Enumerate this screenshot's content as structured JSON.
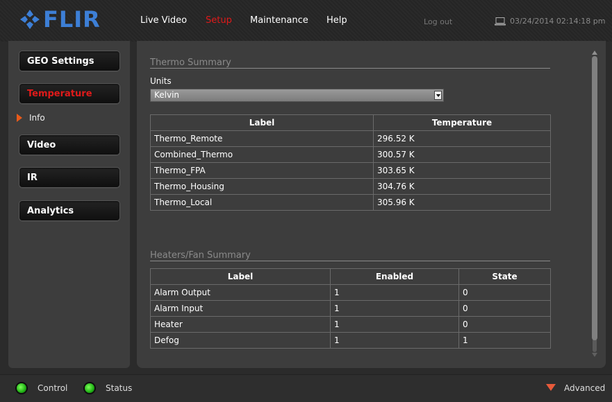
{
  "header": {
    "logo_text": "FLIR",
    "nav": [
      "Live Video",
      "Setup",
      "Maintenance",
      "Help"
    ],
    "active_nav": "Setup",
    "logout_label": "Log out",
    "datetime": "03/24/2014 02:14:18 pm",
    "colors": {
      "accent": "#e01a1a",
      "brand": "#3d7fd6"
    }
  },
  "sidebar": {
    "items": [
      {
        "label": "GEO Settings"
      },
      {
        "label": "Temperature"
      },
      {
        "label": "Video"
      },
      {
        "label": "IR"
      },
      {
        "label": "Analytics"
      }
    ],
    "active_item": "Temperature",
    "sub_item": "Info"
  },
  "thermo": {
    "title": "Thermo Summary",
    "units_label": "Units",
    "units_value": "Kelvin",
    "columns": [
      "Label",
      "Temperature"
    ],
    "rows": [
      [
        "Thermo_Remote",
        "296.52 K"
      ],
      [
        "Combined_Thermo",
        "300.57 K"
      ],
      [
        "Thermo_FPA",
        "303.65 K"
      ],
      [
        "Thermo_Housing",
        "304.76 K"
      ],
      [
        "Thermo_Local",
        "305.96 K"
      ]
    ]
  },
  "heaters": {
    "title": "Heaters/Fan Summary",
    "columns": [
      "Label",
      "Enabled",
      "State"
    ],
    "rows": [
      [
        "Alarm Output",
        "1",
        "0"
      ],
      [
        "Alarm Input",
        "1",
        "0"
      ],
      [
        "Heater",
        "1",
        "0"
      ],
      [
        "Defog",
        "1",
        "1"
      ]
    ]
  },
  "footer": {
    "control_label": "Control",
    "status_label": "Status",
    "advanced_label": "Advanced"
  }
}
